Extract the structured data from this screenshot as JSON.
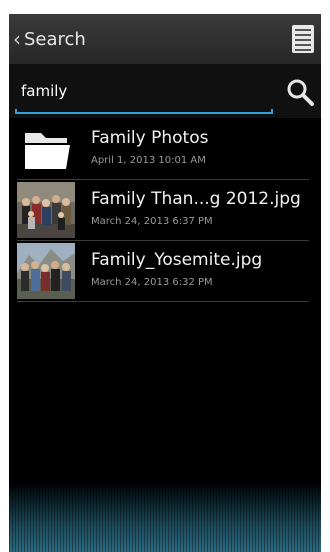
{
  "header": {
    "back_label": "Search"
  },
  "search": {
    "value": "family"
  },
  "results": [
    {
      "name": "Family Photos",
      "date": "April 1, 2013 10:01 AM",
      "kind": "folder"
    },
    {
      "name": "Family Than...g 2012.jpg",
      "date": "March 24, 2013 6:37 PM",
      "kind": "photo"
    },
    {
      "name": "Family_Yosemite.jpg",
      "date": "March 24, 2013 6:32 PM",
      "kind": "photo"
    }
  ],
  "colors": {
    "accent": "#2fa3d6",
    "background": "#000000",
    "titlebar": "#2e2e2e"
  },
  "icons": {
    "back": "chevron-left-icon",
    "menu": "list-menu-icon",
    "search": "search-icon",
    "folder": "folder-icon"
  }
}
